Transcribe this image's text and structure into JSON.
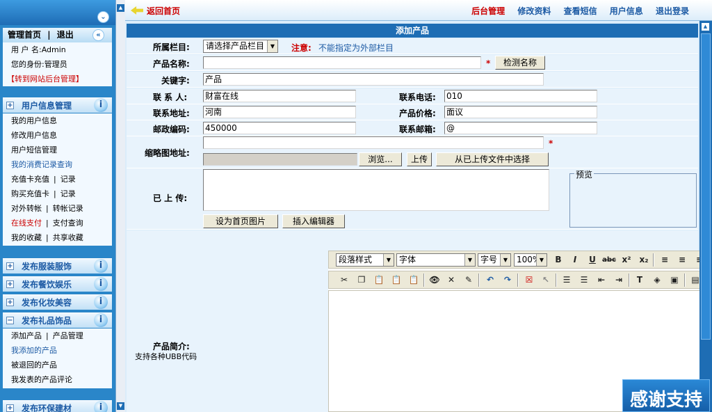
{
  "sidebar": {
    "account": {
      "home_link": "管理首页",
      "sep": "|",
      "logout_link": "退出",
      "username_label": "用 户 名:",
      "username": "Admin",
      "role_label": "您的身份:",
      "role": "管理员",
      "admin_link": "【转到网站后台管理】"
    },
    "user_info": {
      "title": "用户信息管理",
      "items": [
        "我的用户信息",
        "修改用户信息",
        "用户短信管理",
        "我的消费记录查询"
      ],
      "pairs": [
        {
          "a": "充值卡充值",
          "b": "记录"
        },
        {
          "a": "购买充值卡",
          "b": "记录"
        },
        {
          "a": "对外转帐",
          "b": "转帐记录"
        },
        {
          "a": "在线支付",
          "b": "支付查询"
        },
        {
          "a": "我的收藏",
          "b": "共享收藏"
        }
      ]
    },
    "groups": [
      {
        "title": "发布服装服饰",
        "pm": "+"
      },
      {
        "title": "发布餐饮娱乐",
        "pm": "+"
      },
      {
        "title": "发布化妆美容",
        "pm": "+"
      },
      {
        "title": "发布礼品饰品",
        "pm": "−"
      }
    ],
    "gift": {
      "pair": {
        "a": "添加产品",
        "b": "产品管理"
      },
      "items": [
        "我添加的产品",
        "被退回的产品",
        "我发表的产品评论"
      ]
    },
    "last_group": {
      "title": "发布环保建材",
      "pm": "+"
    }
  },
  "topbar": {
    "back": "返回首页",
    "nav": [
      "后台管理",
      "修改资料",
      "查看短信",
      "用户信息",
      "退出登录"
    ]
  },
  "form": {
    "title": "添加产品",
    "column_label": "所属栏目:",
    "column_value": "请选择产品栏目",
    "note_label": "注意:",
    "note_text": "不能指定为外部栏目",
    "name_label": "产品名称:",
    "check_button": "检测名称",
    "keyword_label": "关键字:",
    "keyword_value": "产品",
    "contact_label": "联 系 人:",
    "contact_value": "财富在线",
    "phone_label": "联系电话:",
    "phone_value": "010",
    "address_label": "联系地址:",
    "address_value": "河南",
    "price_label": "产品价格:",
    "price_value": "面议",
    "zip_label": "邮政编码:",
    "zip_value": "450000",
    "email_label": "联系邮箱:",
    "email_value": "@",
    "thumb_label": "缩略图地址:",
    "browse_button": "浏览...",
    "upload_button": "上传",
    "choose_button": "从已上传文件中选择",
    "uploaded_label": "已 上 传:",
    "preview_legend": "预览",
    "set_home_button": "设为首页图片",
    "insert_editor_button": "插入编辑器",
    "intro_label": "产品简介:",
    "intro_sub": "支持各种UBB代码",
    "required_mark": "*"
  },
  "editor": {
    "format_select": "段落样式",
    "font_select": "字体",
    "size_select": "字号",
    "zoom_select": "100%"
  },
  "promo": "感谢支持"
}
